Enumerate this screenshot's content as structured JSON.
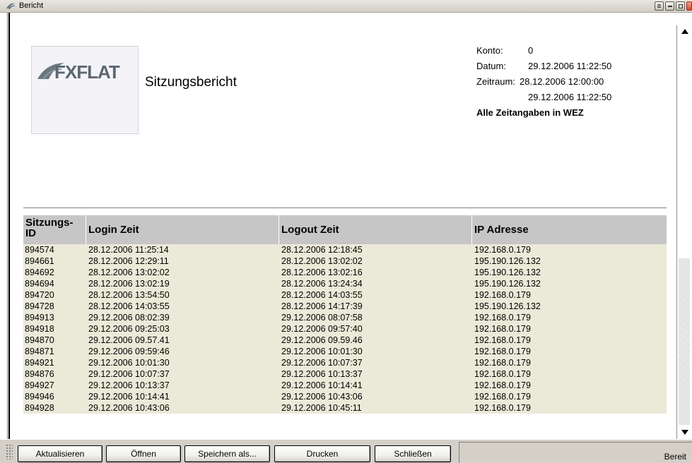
{
  "window": {
    "title": "Bericht",
    "buttons": [
      "restore-icon",
      "minimize-icon",
      "maximize-icon",
      "close-icon"
    ]
  },
  "report": {
    "logo_text": "FXFLAT",
    "title": "Sitzungsbericht",
    "info": {
      "konto_label": "Konto:",
      "konto_value": "0",
      "datum_label": "Datum:",
      "datum_value": "29.12.2006 11:22:50",
      "zeitraum_label": "Zeitraum:",
      "zeitraum_from": "28.12.2006 12:00:00",
      "zeitraum_to": "29.12.2006 11:22:50",
      "note": "Alle Zeitangaben in WEZ"
    }
  },
  "table": {
    "columns": [
      "Sitzungs-\nID",
      "Login Zeit",
      "Logout Zeit",
      "IP Adresse"
    ],
    "rows": [
      [
        "894574",
        "28.12.2006 11:25:14",
        "28.12.2006 12:18:45",
        "192.168.0.179"
      ],
      [
        "894661",
        "28.12.2006 12:29:11",
        "28.12.2006 13:02:02",
        "195.190.126.132"
      ],
      [
        "894692",
        "28.12.2006 13:02:02",
        "28.12.2006 13:02:16",
        "195.190.126.132"
      ],
      [
        "894694",
        "28.12.2006 13:02:19",
        "28.12.2006 13:24:34",
        "195.190.126.132"
      ],
      [
        "894720",
        "28.12.2006 13:54:50",
        "28.12.2006 14:03:55",
        "192.168.0.179"
      ],
      [
        "894728",
        "28.12.2006 14:03:55",
        "28.12.2006 14:17:39",
        "195.190.126.132"
      ],
      [
        "894913",
        "29.12.2006 08:02:39",
        "29.12.2006 08:07:58",
        "192.168.0.179"
      ],
      [
        "894918",
        "29.12.2006 09:25:03",
        "29.12.2006 09:57:40",
        "192.168.0.179"
      ],
      [
        "894870",
        "29.12.2006 09.57.41",
        "29.12.2006 09.59.46",
        "192.168.0.179"
      ],
      [
        "894871",
        "29.12.2006 09:59:46",
        "29.12.2006 10:01:30",
        "192.168.0.179"
      ],
      [
        "894921",
        "29.12.2006 10:01:30",
        "29.12.2006 10:07:37",
        "192.168.0.179"
      ],
      [
        "894876",
        "29.12.2006 10:07:37",
        "29.12.2006 10:13:37",
        "192.168.0.179"
      ],
      [
        "894927",
        "29.12.2006 10:13:37",
        "29.12.2006 10:14:41",
        "192.168.0.179"
      ],
      [
        "894946",
        "29.12.2006 10:14:41",
        "29.12.2006 10:43:06",
        "192.168.0.179"
      ],
      [
        "894928",
        "29.12.2006 10:43:06",
        "29.12.2006 10:45:11",
        "192.168.0.179"
      ]
    ]
  },
  "toolbar": {
    "buttons": [
      "Aktualisieren",
      "Öffnen",
      "Speichern als...",
      "Drucken",
      "Schließen"
    ],
    "status": "Bereit"
  },
  "colors": {
    "row_bg": "#ebe9d8",
    "header_bg": "#c6c6c6",
    "toolbar_bg": "#d4d0c8"
  }
}
